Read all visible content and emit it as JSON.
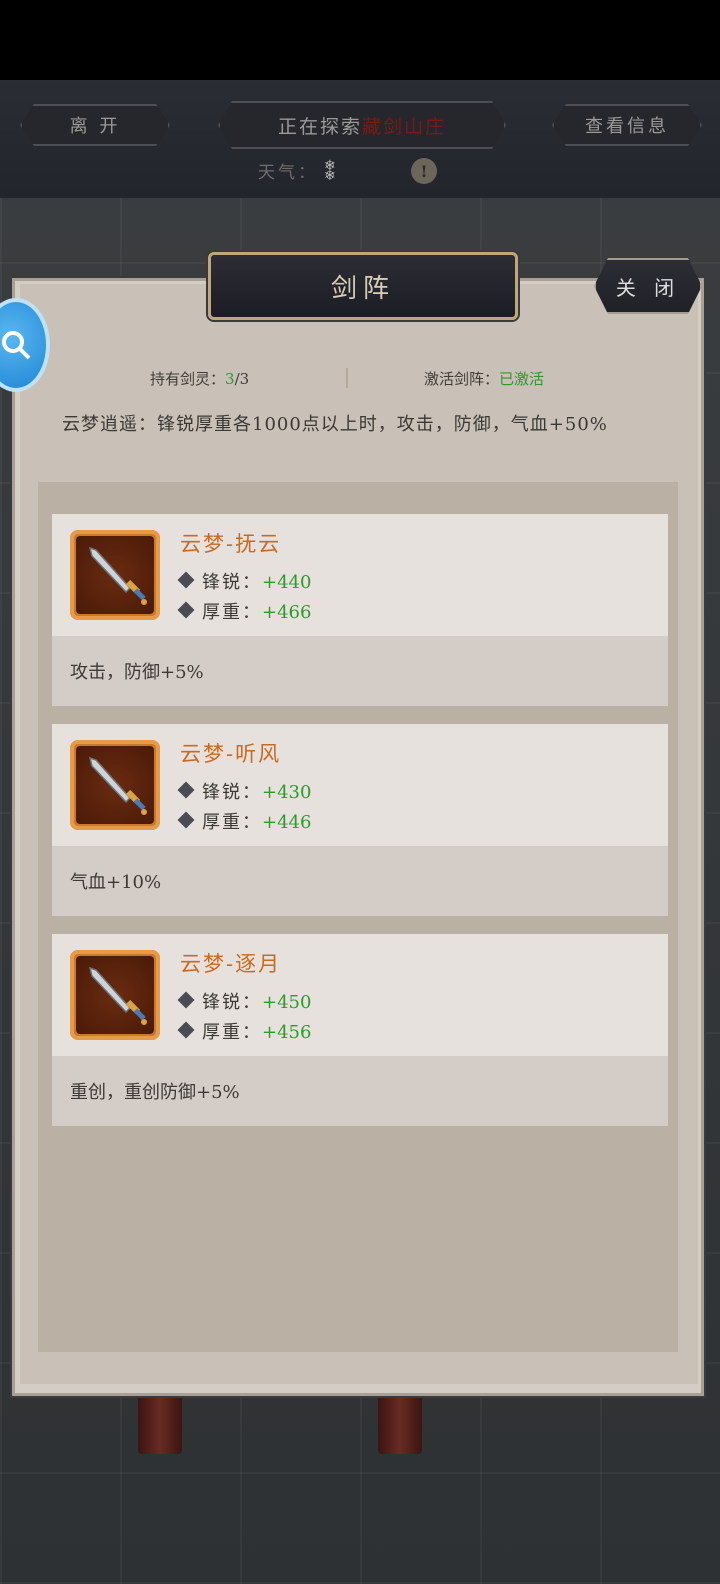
{
  "header": {
    "leave_label": "离 开",
    "explore_prefix": "正在探索",
    "explore_place": "藏剑山庄",
    "info_label": "查看信息",
    "weather_label": "天气：",
    "warn_glyph": "!"
  },
  "panel": {
    "title": "剑阵",
    "close_label": "关 闭",
    "holding_label": "持有剑灵：",
    "holding_value": "3",
    "holding_total": "/3",
    "activate_label": "激活剑阵：",
    "activate_value": "已激活",
    "description": "云梦逍遥：锋锐厚重各1000点以上时，攻击，防御，气血+50%"
  },
  "cards": [
    {
      "name": "云梦-抚云",
      "attr1_label": "锋锐：",
      "attr1_value": "+440",
      "attr2_label": "厚重：",
      "attr2_value": "+466",
      "bonus": "攻击，防御+5%"
    },
    {
      "name": "云梦-听风",
      "attr1_label": "锋锐：",
      "attr1_value": "+430",
      "attr2_label": "厚重：",
      "attr2_value": "+446",
      "bonus": "气血+10%"
    },
    {
      "name": "云梦-逐月",
      "attr1_label": "锋锐：",
      "attr1_value": "+450",
      "attr2_label": "厚重：",
      "attr2_value": "+456",
      "bonus": "重创，重创防御+5%"
    }
  ],
  "icons": {
    "sword": "sword-icon",
    "side": "magnifier-icon",
    "weather": "snow-icon"
  },
  "colors": {
    "accent_orange": "#c86a20",
    "accent_green": "#2d9a2a",
    "place_red": "#7a1a16"
  }
}
